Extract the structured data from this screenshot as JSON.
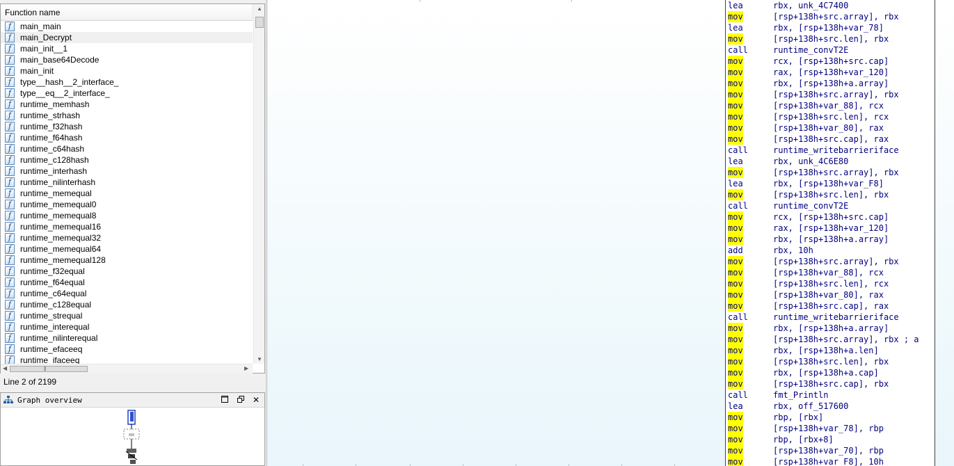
{
  "functions_panel": {
    "header": "Function name",
    "selected_index": 1,
    "items": [
      "main_main",
      "main_Decrypt",
      "main_init__1",
      "main_base64Decode",
      "main_init",
      "type__hash__2_interface_",
      "type__eq__2_interface_",
      "runtime_memhash",
      "runtime_strhash",
      "runtime_f32hash",
      "runtime_f64hash",
      "runtime_c64hash",
      "runtime_c128hash",
      "runtime_interhash",
      "runtime_nilinterhash",
      "runtime_memequal",
      "runtime_memequal0",
      "runtime_memequal8",
      "runtime_memequal16",
      "runtime_memequal32",
      "runtime_memequal64",
      "runtime_memequal128",
      "runtime_f32equal",
      "runtime_f64equal",
      "runtime_c64equal",
      "runtime_c128equal",
      "runtime_strequal",
      "runtime_interequal",
      "runtime_nilinterequal",
      "runtime_efaceeq",
      "runtime_ifaceeq"
    ],
    "icon": "function-icon"
  },
  "status": {
    "line": "Line 2 of 2199"
  },
  "graph_overview": {
    "title": "Graph overview",
    "icon": "graph-tree-icon",
    "buttons": [
      "restore",
      "float",
      "close"
    ]
  },
  "disassembly": {
    "highlight_mnemonic": "mov",
    "highlight_color": "#ffff00",
    "lines": [
      {
        "m": "lea",
        "o": "rbx, unk_4C7400"
      },
      {
        "m": "mov",
        "o": "[rsp+138h+src.array], rbx"
      },
      {
        "m": "lea",
        "o": "rbx, [rsp+138h+var_78]"
      },
      {
        "m": "mov",
        "o": "[rsp+138h+src.len], rbx"
      },
      {
        "m": "call",
        "o": "runtime_convT2E"
      },
      {
        "m": "mov",
        "o": "rcx, [rsp+138h+src.cap]"
      },
      {
        "m": "mov",
        "o": "rax, [rsp+138h+var_120]"
      },
      {
        "m": "mov",
        "o": "rbx, [rsp+138h+a.array]"
      },
      {
        "m": "mov",
        "o": "[rsp+138h+src.array], rbx"
      },
      {
        "m": "mov",
        "o": "[rsp+138h+var_88], rcx"
      },
      {
        "m": "mov",
        "o": "[rsp+138h+src.len], rcx"
      },
      {
        "m": "mov",
        "o": "[rsp+138h+var_80], rax"
      },
      {
        "m": "mov",
        "o": "[rsp+138h+src.cap], rax"
      },
      {
        "m": "call",
        "o": "runtime_writebarrieriface"
      },
      {
        "m": "lea",
        "o": "rbx, unk_4C6E80"
      },
      {
        "m": "mov",
        "o": "[rsp+138h+src.array], rbx"
      },
      {
        "m": "lea",
        "o": "rbx, [rsp+138h+var_F8]"
      },
      {
        "m": "mov",
        "o": "[rsp+138h+src.len], rbx"
      },
      {
        "m": "call",
        "o": "runtime_convT2E"
      },
      {
        "m": "mov",
        "o": "rcx, [rsp+138h+src.cap]"
      },
      {
        "m": "mov",
        "o": "rax, [rsp+138h+var_120]"
      },
      {
        "m": "mov",
        "o": "rbx, [rsp+138h+a.array]"
      },
      {
        "m": "add",
        "o": "rbx, 10h"
      },
      {
        "m": "mov",
        "o": "[rsp+138h+src.array], rbx"
      },
      {
        "m": "mov",
        "o": "[rsp+138h+var_88], rcx"
      },
      {
        "m": "mov",
        "o": "[rsp+138h+src.len], rcx"
      },
      {
        "m": "mov",
        "o": "[rsp+138h+var_80], rax"
      },
      {
        "m": "mov",
        "o": "[rsp+138h+src.cap], rax"
      },
      {
        "m": "call",
        "o": "runtime_writebarrieriface"
      },
      {
        "m": "mov",
        "o": "rbx, [rsp+138h+a.array]"
      },
      {
        "m": "mov",
        "o": "[rsp+138h+src.array], rbx ; a"
      },
      {
        "m": "mov",
        "o": "rbx, [rsp+138h+a.len]"
      },
      {
        "m": "mov",
        "o": "[rsp+138h+src.len], rbx"
      },
      {
        "m": "mov",
        "o": "rbx, [rsp+138h+a.cap]"
      },
      {
        "m": "mov",
        "o": "[rsp+138h+src.cap], rbx"
      },
      {
        "m": "call",
        "o": "fmt_Println"
      },
      {
        "m": "lea",
        "o": "rbx, off_517600"
      },
      {
        "m": "mov",
        "o": "rbp, [rbx]"
      },
      {
        "m": "mov",
        "o": "[rsp+138h+var_78], rbp"
      },
      {
        "m": "mov",
        "o": "rbp, [rbx+8]"
      },
      {
        "m": "mov",
        "o": "[rsp+138h+var_70], rbp"
      },
      {
        "m": "mov",
        "o": "[rsp+138h+var_F8], 10h"
      }
    ]
  }
}
